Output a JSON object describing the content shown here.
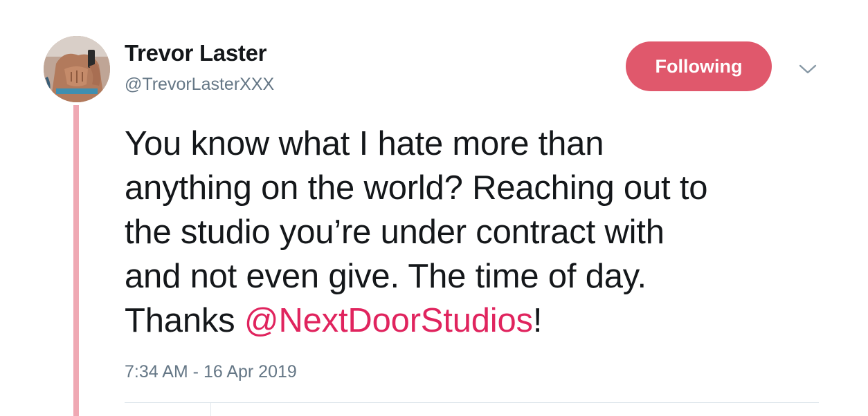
{
  "tweet": {
    "author": {
      "display_name": "Trevor Laster",
      "handle": "@TrevorLasterXXX",
      "avatar_icon": "profile-photo"
    },
    "follow_button_label": "Following",
    "menu_icon": "chevron-down-icon",
    "text_before_mention": "You know what I hate more than\nanything on the world? Reaching out to\nthe studio you’re under contract with\nand not even give. The time of day.\nThanks ",
    "mention": "@NextDoorStudios",
    "text_after_mention": "!",
    "timestamp": "7:34 AM - 16 Apr 2019"
  },
  "colors": {
    "accent": "#e0586c",
    "mention": "#e0245e",
    "thread_line": "#efa8b3",
    "secondary_text": "#657786",
    "primary_text": "#14171a"
  }
}
